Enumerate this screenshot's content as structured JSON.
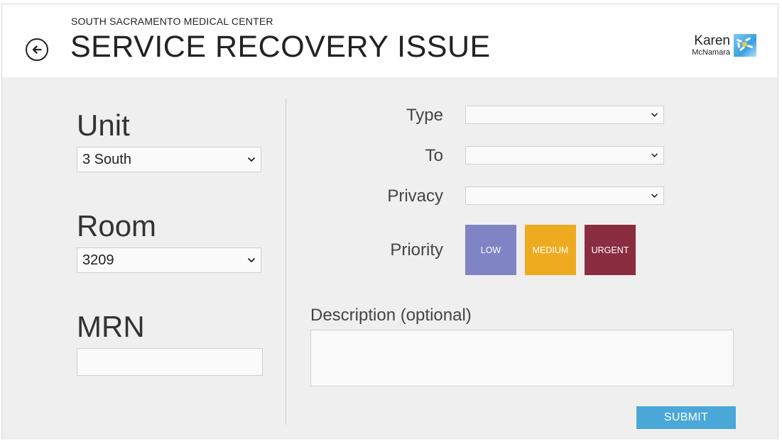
{
  "header": {
    "organization": "SOUTH SACRAMENTO MEDICAL CENTER",
    "title": "SERVICE RECOVERY ISSUE",
    "back_icon": "back-arrow-circle-icon"
  },
  "user": {
    "first_name": "Karen",
    "last_name": "McNamara",
    "avatar_icon": "daisy-avatar-icon"
  },
  "left_form": {
    "unit_label": "Unit",
    "unit_value": "3 South",
    "room_label": "Room",
    "room_value": "3209",
    "mrn_label": "MRN",
    "mrn_value": ""
  },
  "right_form": {
    "type_label": "Type",
    "type_value": "",
    "to_label": "To",
    "to_value": "",
    "privacy_label": "Privacy",
    "privacy_value": "",
    "priority_label": "Priority",
    "priority_options": [
      {
        "label": "LOW",
        "color": "#8083c4"
      },
      {
        "label": "MEDIUM",
        "color": "#efab20"
      },
      {
        "label": "URGENT",
        "color": "#8a2d40"
      }
    ],
    "description_label": "Description (optional)",
    "description_value": ""
  },
  "actions": {
    "submit_label": "SUBMIT",
    "submit_color": "#4aa8d8"
  },
  "colors": {
    "background": "#efefef",
    "header_bg": "#ffffff",
    "text": "#222222"
  }
}
